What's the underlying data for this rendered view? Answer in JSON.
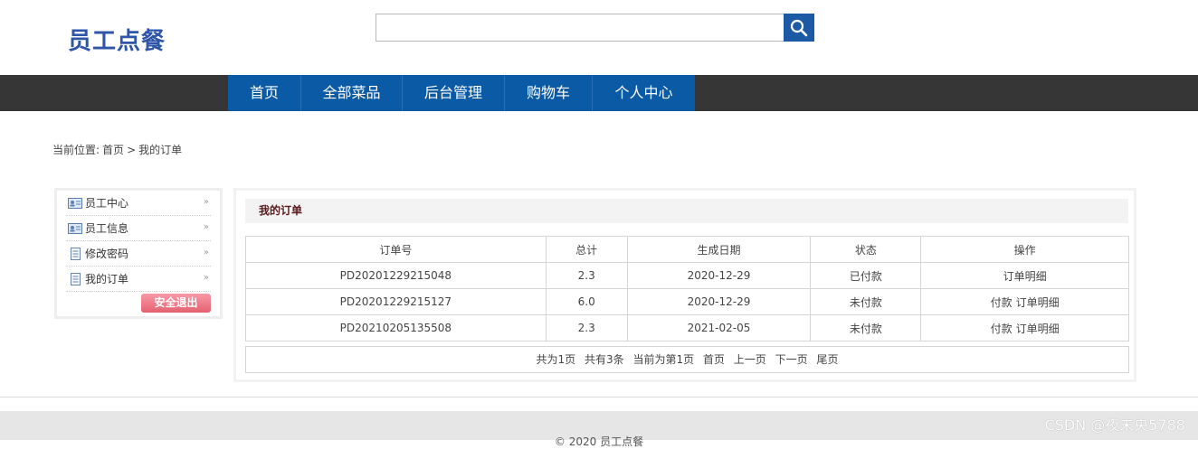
{
  "header": {
    "logo": "员工点餐",
    "search_placeholder": ""
  },
  "nav": [
    "首页",
    "全部菜品",
    "后台管理",
    "购物车",
    "个人中心"
  ],
  "breadcrumb": {
    "prefix": "当前位置:",
    "home": "首页",
    "sep": ">",
    "current": "我的订单"
  },
  "sidebar": {
    "items": [
      {
        "label": "员工中心",
        "icon": "user-card-icon"
      },
      {
        "label": "员工信息",
        "icon": "user-card-icon"
      },
      {
        "label": "修改密码",
        "icon": "document-icon"
      },
      {
        "label": "我的订单",
        "icon": "document-icon"
      }
    ],
    "logout": "安全退出"
  },
  "panel": {
    "title": "我的订单",
    "columns": [
      "订单号",
      "总计",
      "生成日期",
      "状态",
      "操作"
    ],
    "rows": [
      {
        "id": "PD20201229215048",
        "total": "2.3",
        "date": "2020-12-29",
        "status": "已付款",
        "ops": [
          "订单明细"
        ]
      },
      {
        "id": "PD20201229215127",
        "total": "6.0",
        "date": "2020-12-29",
        "status": "未付款",
        "ops": [
          "付款",
          "订单明细"
        ]
      },
      {
        "id": "PD20210205135508",
        "total": "2.3",
        "date": "2021-02-05",
        "status": "未付款",
        "ops": [
          "付款",
          "订单明细"
        ]
      }
    ],
    "pager": {
      "total_pages": "共为1页",
      "total_items": "共有3条",
      "current": "当前为第1页",
      "first": "首页",
      "prev": "上一页",
      "next": "下一页",
      "last": "尾页"
    }
  },
  "footer": {
    "copyright": "© 2020 员工点餐"
  },
  "watermark": "CSDN @夜未央5788",
  "colors": {
    "brand_blue": "#0b5aa6",
    "nav_bg": "#363636",
    "logo": "#2f55a8",
    "logout": "#e4606f"
  }
}
